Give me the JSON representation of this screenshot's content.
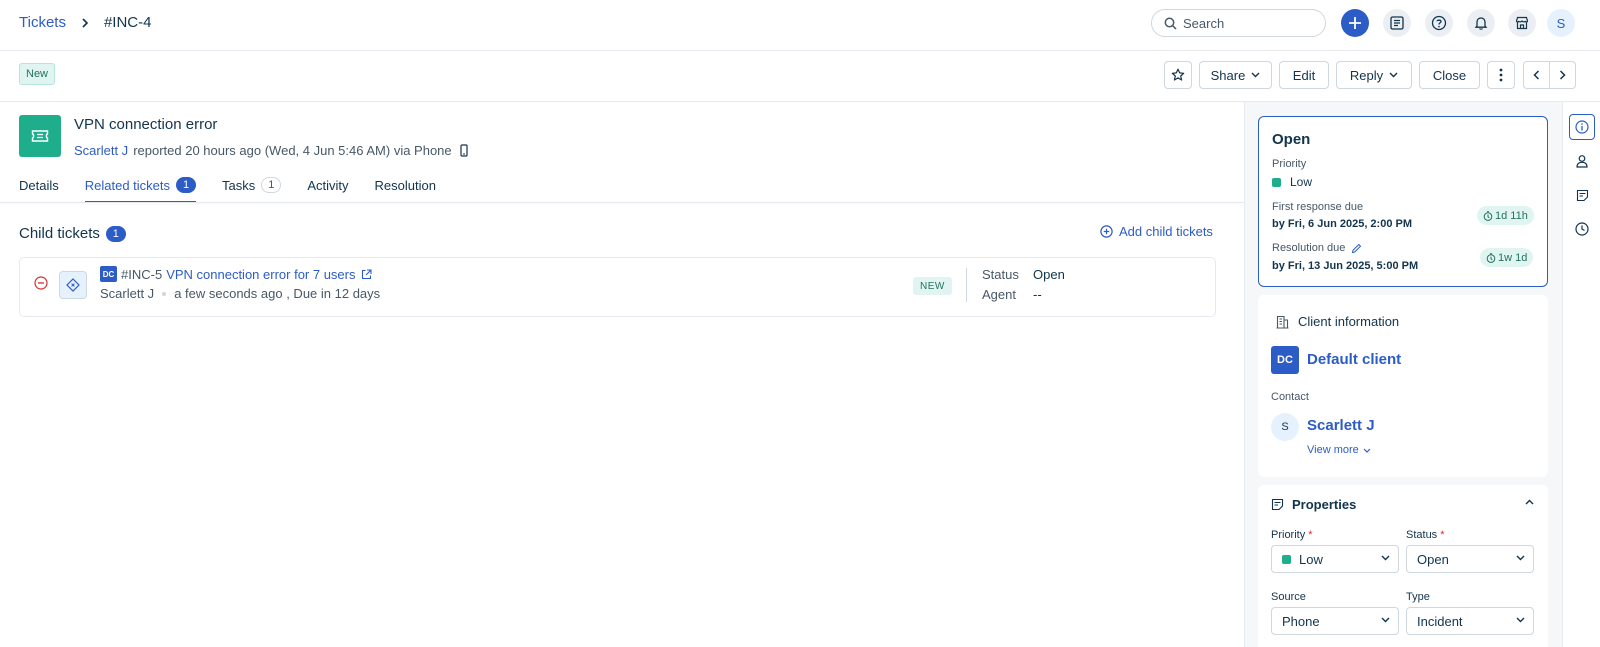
{
  "breadcrumb": {
    "root": "Tickets",
    "current": "#INC-4"
  },
  "search": {
    "placeholder": "Search"
  },
  "user": {
    "initial": "S"
  },
  "ticket": {
    "status_badge": "New",
    "title": "VPN connection error",
    "reporter": "Scarlett J",
    "reported_text": "reported 20 hours ago (Wed, 4 Jun 5:46 AM) via Phone"
  },
  "actions": {
    "share": "Share",
    "edit": "Edit",
    "reply": "Reply",
    "close": "Close"
  },
  "tabs": [
    {
      "label": "Details"
    },
    {
      "label": "Related tickets",
      "count": "1"
    },
    {
      "label": "Tasks",
      "count": "1"
    },
    {
      "label": "Activity"
    },
    {
      "label": "Resolution"
    }
  ],
  "child_section": {
    "title": "Child tickets",
    "count": "1",
    "add_label": "Add child tickets",
    "items": [
      {
        "client_initials": "DC",
        "id": "#INC-5",
        "title": "VPN connection error for 7 users",
        "requester": "Scarlett J",
        "meta": "a few seconds ago , Due in 12 days",
        "badge": "NEW",
        "status_label": "Status",
        "status_value": "Open",
        "agent_label": "Agent",
        "agent_value": "--"
      }
    ]
  },
  "status_card": {
    "title": "Open",
    "priority_label": "Priority",
    "priority_value": "Low",
    "first_response_label": "First response due",
    "first_response_due": "by Fri, 6 Jun 2025, 2:00 PM",
    "first_response_sla": "1d 11h",
    "resolution_label": "Resolution due",
    "resolution_due": "by Fri, 13 Jun 2025, 5:00 PM",
    "resolution_sla": "1w 1d"
  },
  "client_card": {
    "heading": "Client information",
    "client_initials": "DC",
    "client_name": "Default client",
    "contact_label": "Contact",
    "contact_initial": "S",
    "contact_name": "Scarlett J",
    "view_more": "View more"
  },
  "properties": {
    "heading": "Properties",
    "priority_label": "Priority",
    "priority_value": "Low",
    "status_label": "Status",
    "status_value": "Open",
    "source_label": "Source",
    "source_value": "Phone",
    "type_label": "Type",
    "type_value": "Incident",
    "required_mark": "*"
  },
  "colors": {
    "accent": "#2c5cc5",
    "success": "#1eae8c",
    "danger": "#d72d30"
  }
}
